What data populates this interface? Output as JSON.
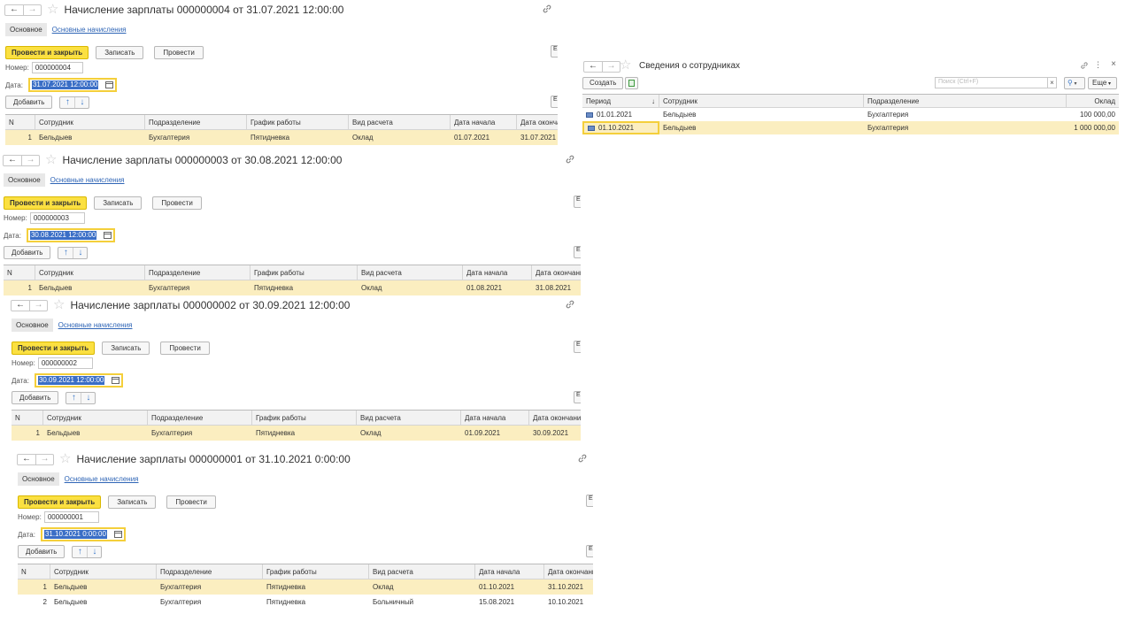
{
  "common": {
    "back": "←",
    "forward": "→",
    "star": "☆",
    "tab_main": "Основное",
    "tab_accruals": "Основные начисления",
    "btn_post_close": "Провести и закрыть",
    "btn_save": "Записать",
    "btn_post": "Провести",
    "btn_edge": "Е",
    "label_number": "Номер:",
    "label_date": "Дата:",
    "btn_add": "Добавить",
    "arrow_up": "↑",
    "arrow_down": "↓",
    "columns": [
      "N",
      "Сотрудник",
      "Подразделение",
      "График работы",
      "Вид расчета",
      "Дата начала",
      "Дата окончания"
    ]
  },
  "docs": [
    {
      "title": "Начисление зарплаты 000000004 от 31.07.2021 12:00:00",
      "number": "000000004",
      "date": "31.07.2021 12:00:00",
      "rows": [
        [
          "1",
          "Бельдыев",
          "Бухгалтерия",
          "Пятидневка",
          "Оклад",
          "01.07.2021",
          "31.07.2021"
        ]
      ]
    },
    {
      "title": "Начисление зарплаты 000000003 от 30.08.2021 12:00:00",
      "number": "000000003",
      "date": "30.08.2021 12:00:00",
      "rows": [
        [
          "1",
          "Бельдыев",
          "Бухгалтерия",
          "Пятидневка",
          "Оклад",
          "01.08.2021",
          "31.08.2021"
        ]
      ]
    },
    {
      "title": "Начисление зарплаты 000000002 от 30.09.2021 12:00:00",
      "number": "000000002",
      "date": "30.09.2021 12:00:00",
      "rows": [
        [
          "1",
          "Бельдыев",
          "Бухгалтерия",
          "Пятидневка",
          "Оклад",
          "01.09.2021",
          "30.09.2021"
        ]
      ]
    },
    {
      "title": "Начисление зарплаты 000000001 от 31.10.2021 0:00:00",
      "number": "000000001",
      "date": "31.10.2021  0:00:00",
      "rows": [
        [
          "1",
          "Бельдыев",
          "Бухгалтерия",
          "Пятидневка",
          "Оклад",
          "01.10.2021",
          "31.10.2021"
        ],
        [
          "2",
          "Бельдыев",
          "Бухгалтерия",
          "Пятидневка",
          "Больничный",
          "15.08.2021",
          "10.10.2021"
        ]
      ]
    }
  ],
  "panel": {
    "title": "Сведения о сотрудниках",
    "btn_create": "Создать",
    "search_placeholder": "Поиск (Ctrl+F)",
    "search_clear": "×",
    "btn_more": "Еще",
    "sort_arrow": "↓",
    "columns": [
      "Период",
      "Сотрудник",
      "Подразделение",
      "Оклад"
    ],
    "rows": [
      [
        "01.01.2021",
        "Бельдыев",
        "Бухгалтерия",
        "100 000,00"
      ],
      [
        "01.10.2021",
        "Бельдыев",
        "Бухгалтерия",
        "1 000 000,00"
      ]
    ]
  }
}
